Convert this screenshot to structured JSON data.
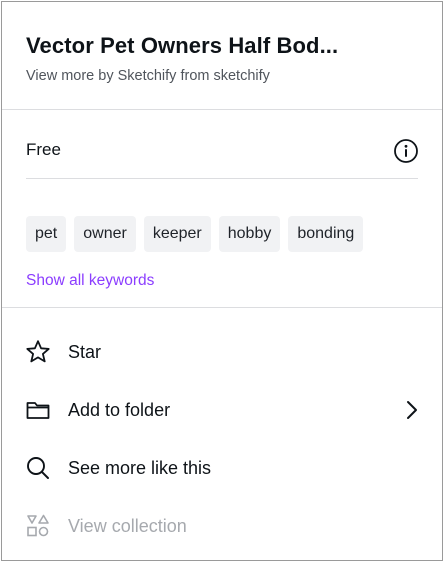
{
  "header": {
    "title": "Vector Pet Owners Half Bod...",
    "subtitle": "View more by Sketchify from sketchify"
  },
  "license": {
    "label": "Free",
    "info_icon": "info-icon"
  },
  "keywords": {
    "items": [
      "pet",
      "owner",
      "keeper",
      "hobby",
      "bonding"
    ],
    "show_all_label": "Show all keywords"
  },
  "menu": {
    "star_label": "Star",
    "add_folder_label": "Add to folder",
    "see_more_label": "See more like this",
    "view_collection_label": "View collection"
  },
  "colors": {
    "accent": "#8b3dff",
    "text": "#0e1318",
    "muted": "#50555c",
    "disabled": "#a6a9ae",
    "chip_bg": "#f1f2f4"
  }
}
